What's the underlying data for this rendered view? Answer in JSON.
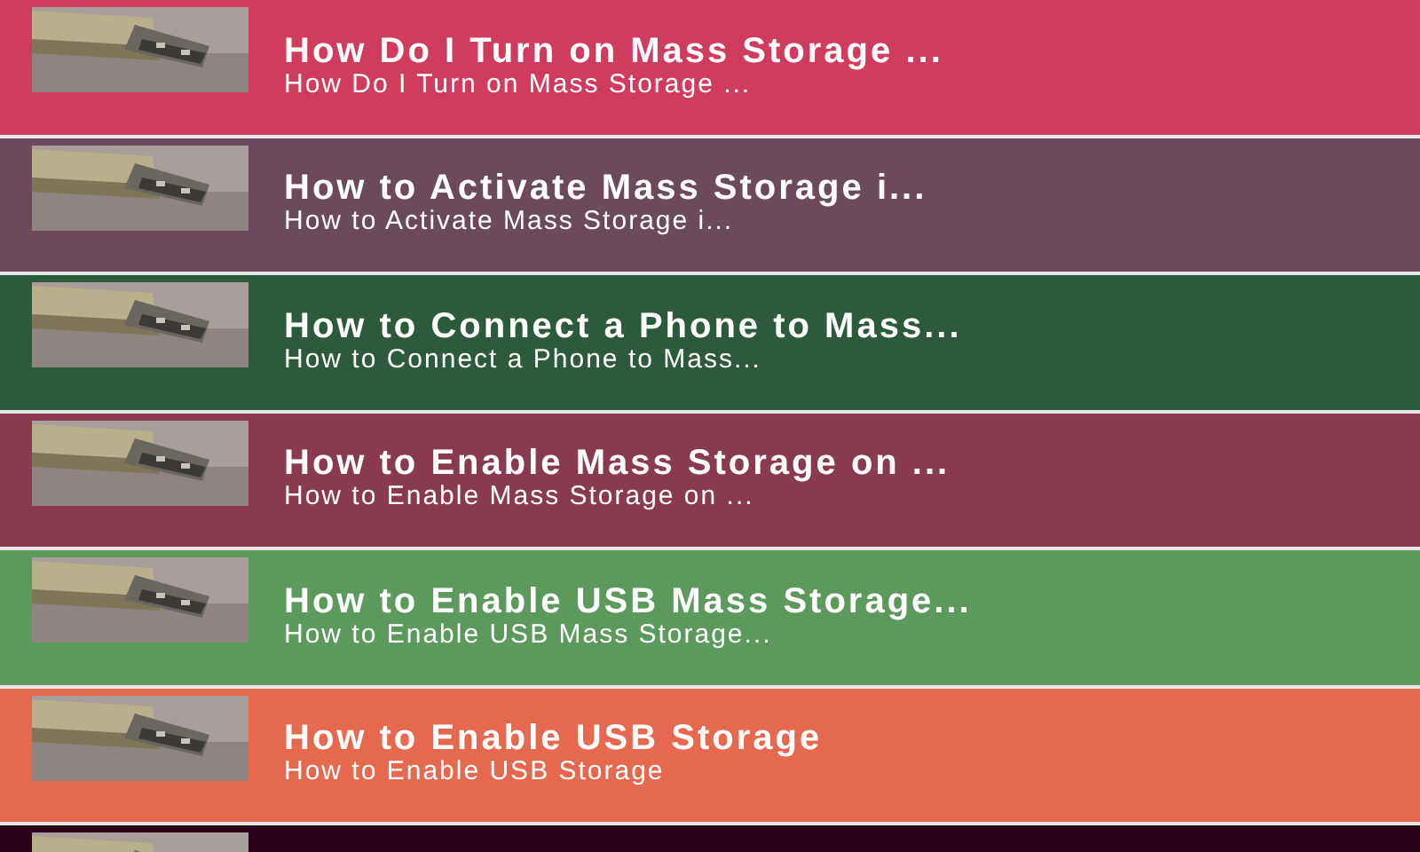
{
  "items": [
    {
      "title": "How Do I Turn on Mass Storage ...",
      "subtitle": "How Do I Turn on Mass Storage ...",
      "color": "#d03c5e"
    },
    {
      "title": "How to Activate Mass Storage i...",
      "subtitle": "How to Activate Mass Storage i...",
      "color": "#6c4a5c"
    },
    {
      "title": "How to Connect a Phone to Mass...",
      "subtitle": "How to Connect a Phone to Mass...",
      "color": "#2c5a3c"
    },
    {
      "title": "How to Enable Mass Storage on ...",
      "subtitle": "How to Enable Mass Storage on ...",
      "color": "#8a3a50"
    },
    {
      "title": "How to Enable USB Mass Storage...",
      "subtitle": "How to Enable USB Mass Storage...",
      "color": "#5c9a5c"
    },
    {
      "title": "How to Enable USB Storage",
      "subtitle": "How to Enable USB Storage",
      "color": "#e6684e"
    },
    {
      "color": "#2c0016"
    }
  ]
}
